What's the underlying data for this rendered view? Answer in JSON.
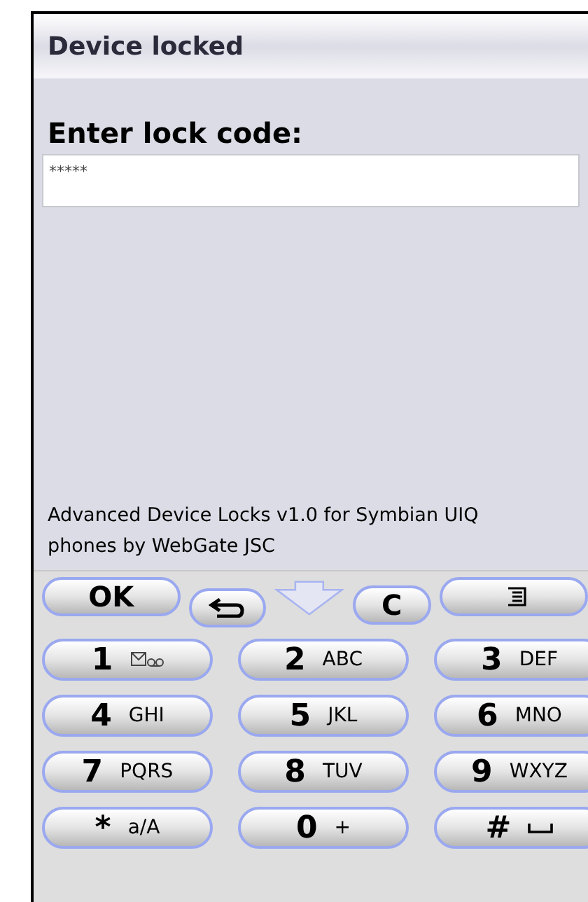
{
  "title": "Device locked",
  "prompt": "Enter lock code:",
  "code_field": {
    "value": "*****"
  },
  "footer": "Advanced Device Locks v1.0 for Symbian UIQ phones by WebGate JSC",
  "soft_keys": [
    {
      "kind": "text",
      "label": "OK"
    },
    {
      "kind": "back"
    },
    {
      "kind": "arrow"
    },
    {
      "kind": "text",
      "label": "C"
    },
    {
      "kind": "menu"
    }
  ],
  "keys": [
    {
      "digit": "1",
      "kind": "voicemail"
    },
    {
      "digit": "2",
      "letters": "ABC",
      "kind": "letters"
    },
    {
      "digit": "3",
      "letters": "DEF",
      "kind": "letters"
    },
    {
      "digit": "4",
      "letters": "GHI",
      "kind": "letters"
    },
    {
      "digit": "5",
      "letters": "JKL",
      "kind": "letters"
    },
    {
      "digit": "6",
      "letters": "MNO",
      "kind": "letters"
    },
    {
      "digit": "7",
      "letters": "PQRS",
      "kind": "letters"
    },
    {
      "digit": "8",
      "letters": "TUV",
      "kind": "letters"
    },
    {
      "digit": "9",
      "letters": "WXYZ",
      "kind": "letters"
    },
    {
      "digit": "*",
      "letters": "a/A",
      "kind": "letters"
    },
    {
      "digit": "0",
      "letters": "+",
      "kind": "letters"
    },
    {
      "digit": "#",
      "kind": "space"
    }
  ]
}
